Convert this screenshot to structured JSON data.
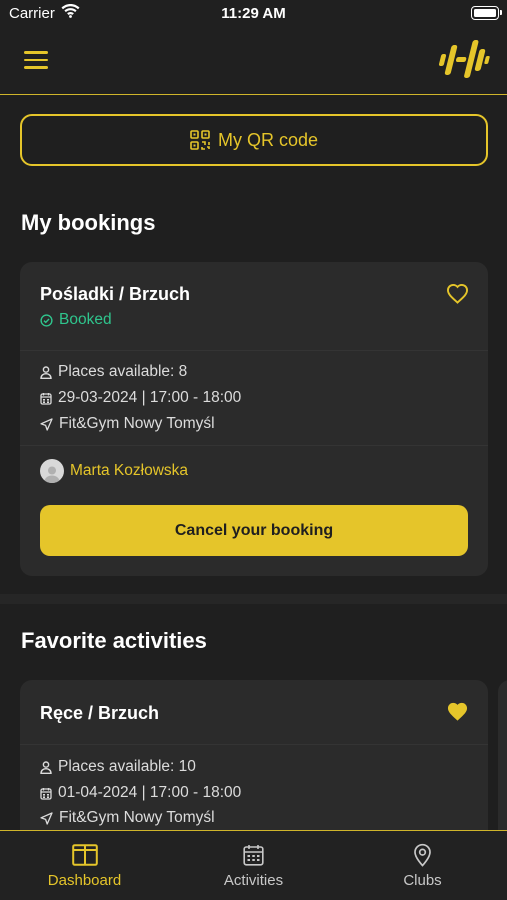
{
  "status_bar": {
    "carrier": "Carrier",
    "time": "11:29 AM"
  },
  "header": {
    "menu_icon": "hamburger-menu-icon",
    "logo": "dumbbell-logo"
  },
  "qr_button": {
    "label": "My QR code",
    "icon": "qr-code-icon"
  },
  "bookings": {
    "title": "My bookings",
    "items": [
      {
        "name": "Pośladki / Brzuch",
        "status": "Booked",
        "favorite": false,
        "places": "Places available: 8",
        "datetime": "29-03-2024 | 17:00 - 18:00",
        "location": "Fit&Gym Nowy Tomyśl",
        "trainer": "Marta Kozłowska",
        "cancel_label": "Cancel your booking"
      }
    ]
  },
  "favorites": {
    "title": "Favorite activities",
    "items": [
      {
        "name": "Ręce / Brzuch",
        "favorite": true,
        "places": "Places available: 10",
        "datetime": "01-04-2024 | 17:00 - 18:00",
        "location": "Fit&Gym Nowy Tomyśl"
      }
    ]
  },
  "tab_bar": {
    "tabs": [
      {
        "label": "Dashboard",
        "icon": "dashboard-icon",
        "active": true
      },
      {
        "label": "Activities",
        "icon": "calendar-icon",
        "active": false
      },
      {
        "label": "Clubs",
        "icon": "location-pin-icon",
        "active": false
      }
    ]
  },
  "colors": {
    "accent": "#e5c52a",
    "success": "#2fc58d",
    "background": "#1f1f1f",
    "card": "#2b2b2b"
  }
}
